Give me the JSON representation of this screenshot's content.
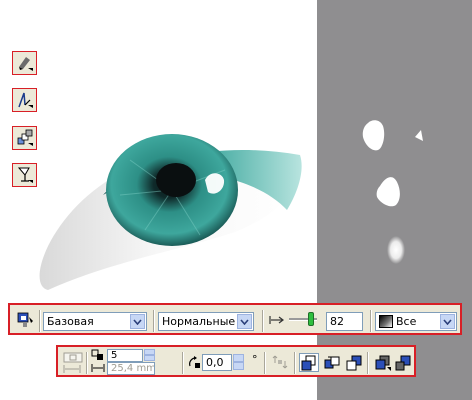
{
  "toolbox": {
    "tools": [
      {
        "icon": "interactive-fill-icon"
      },
      {
        "icon": "interactive-blend-icon"
      },
      {
        "icon": "interactive-transparency-icon"
      },
      {
        "icon": "interactive-effects-icon"
      }
    ]
  },
  "property_bar_transparency": {
    "transparency_type": "Базовая",
    "merge_mode": "Нормальные",
    "opacity_value": "82",
    "apply_to": "Все"
  },
  "property_bar_arrange": {
    "copies_value": "5",
    "offset_value": "25,4 mm",
    "angle_value": "0,0",
    "degree_symbol": "°"
  },
  "colors": {
    "accent_border": "#d81f26",
    "toolbar_bg": "#ece9d8",
    "gray_panel": "#8f8e90",
    "iris": "#2b8f86"
  }
}
